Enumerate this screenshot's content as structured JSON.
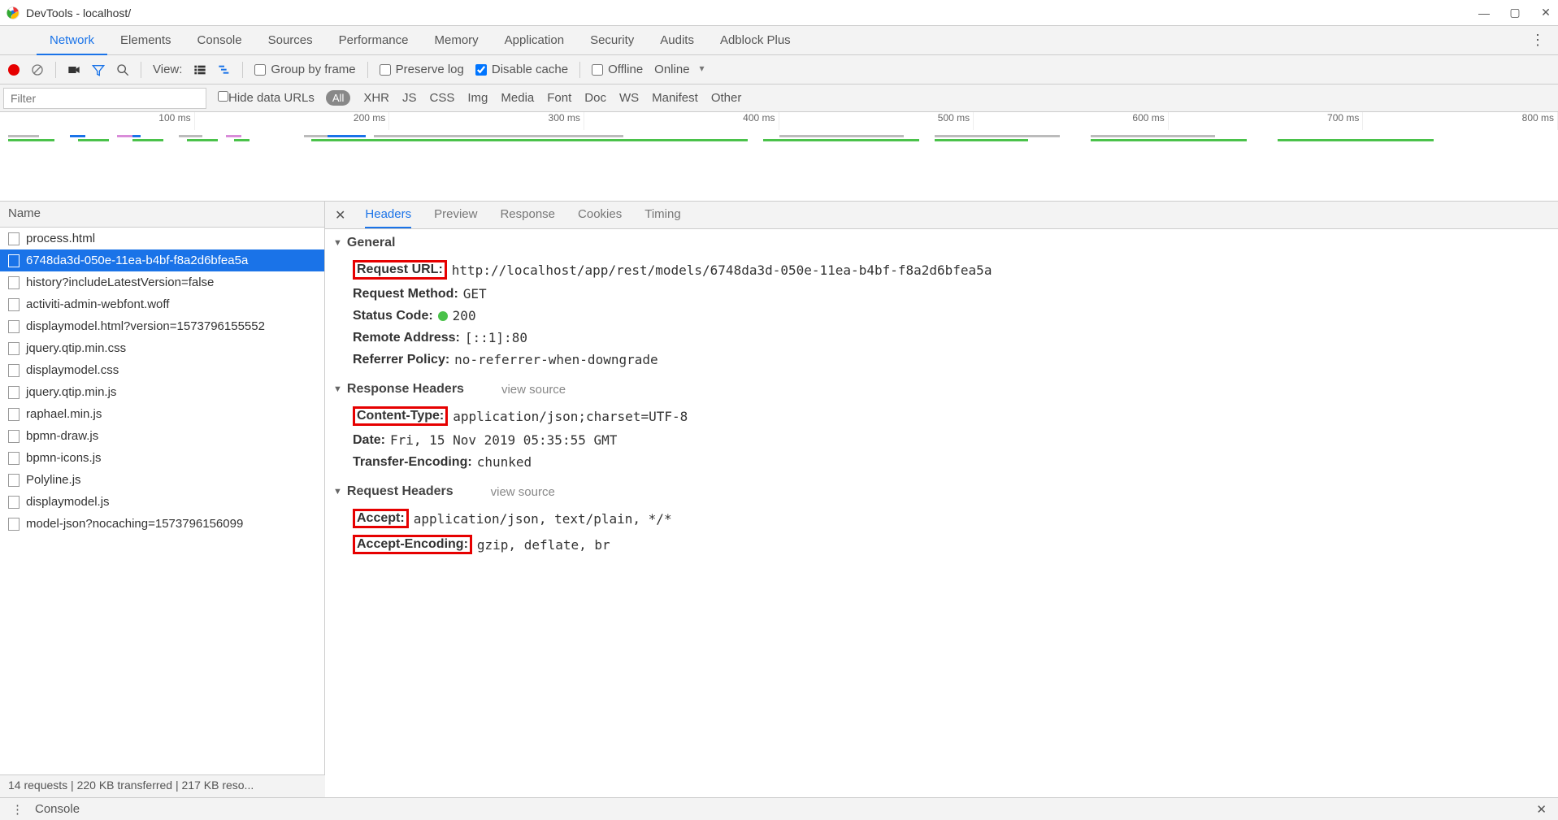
{
  "window": {
    "title": "DevTools - localhost/"
  },
  "tabs": {
    "items": [
      "Network",
      "Elements",
      "Console",
      "Sources",
      "Performance",
      "Memory",
      "Application",
      "Security",
      "Audits",
      "Adblock Plus"
    ],
    "active": "Network"
  },
  "toolbar": {
    "view_label": "View:",
    "group_by_frame": "Group by frame",
    "preserve_log": "Preserve log",
    "disable_cache": "Disable cache",
    "offline": "Offline",
    "online": "Online"
  },
  "filter": {
    "placeholder": "Filter",
    "hide_data_urls": "Hide data URLs",
    "types": [
      "All",
      "XHR",
      "JS",
      "CSS",
      "Img",
      "Media",
      "Font",
      "Doc",
      "WS",
      "Manifest",
      "Other"
    ]
  },
  "timeline": {
    "ticks": [
      "100 ms",
      "200 ms",
      "300 ms",
      "400 ms",
      "500 ms",
      "600 ms",
      "700 ms",
      "800 ms"
    ]
  },
  "namecol": {
    "header": "Name",
    "items": [
      {
        "name": "process.html",
        "selected": false
      },
      {
        "name": "6748da3d-050e-11ea-b4bf-f8a2d6bfea5a",
        "selected": true
      },
      {
        "name": "history?includeLatestVersion=false",
        "selected": false
      },
      {
        "name": "activiti-admin-webfont.woff",
        "selected": false
      },
      {
        "name": "displaymodel.html?version=1573796155552",
        "selected": false
      },
      {
        "name": "jquery.qtip.min.css",
        "selected": false
      },
      {
        "name": "displaymodel.css",
        "selected": false
      },
      {
        "name": "jquery.qtip.min.js",
        "selected": false
      },
      {
        "name": "raphael.min.js",
        "selected": false
      },
      {
        "name": "bpmn-draw.js",
        "selected": false
      },
      {
        "name": "bpmn-icons.js",
        "selected": false
      },
      {
        "name": "Polyline.js",
        "selected": false
      },
      {
        "name": "displaymodel.js",
        "selected": false
      },
      {
        "name": "model-json?nocaching=1573796156099",
        "selected": false
      }
    ],
    "status": "14 requests  |  220 KB transferred  |  217 KB reso..."
  },
  "detail": {
    "tabs": [
      "Headers",
      "Preview",
      "Response",
      "Cookies",
      "Timing"
    ],
    "active": "Headers",
    "general": {
      "title": "General",
      "request_url_label": "Request URL:",
      "request_url": "http://localhost/app/rest/models/6748da3d-050e-11ea-b4bf-f8a2d6bfea5a",
      "request_method_label": "Request Method:",
      "request_method": "GET",
      "status_code_label": "Status Code:",
      "status_code": "200",
      "remote_address_label": "Remote Address:",
      "remote_address": "[::1]:80",
      "referrer_policy_label": "Referrer Policy:",
      "referrer_policy": "no-referrer-when-downgrade"
    },
    "response_headers": {
      "title": "Response Headers",
      "view_source": "view source",
      "content_type_label": "Content-Type:",
      "content_type": "application/json;charset=UTF-8",
      "date_label": "Date:",
      "date": "Fri, 15 Nov 2019 05:35:55 GMT",
      "transfer_encoding_label": "Transfer-Encoding:",
      "transfer_encoding": "chunked"
    },
    "request_headers": {
      "title": "Request Headers",
      "view_source": "view source",
      "accept_label": "Accept:",
      "accept": "application/json, text/plain, */*",
      "accept_encoding_label": "Accept-Encoding:",
      "accept_encoding": "gzip, deflate, br"
    }
  },
  "footer": {
    "console": "Console"
  }
}
